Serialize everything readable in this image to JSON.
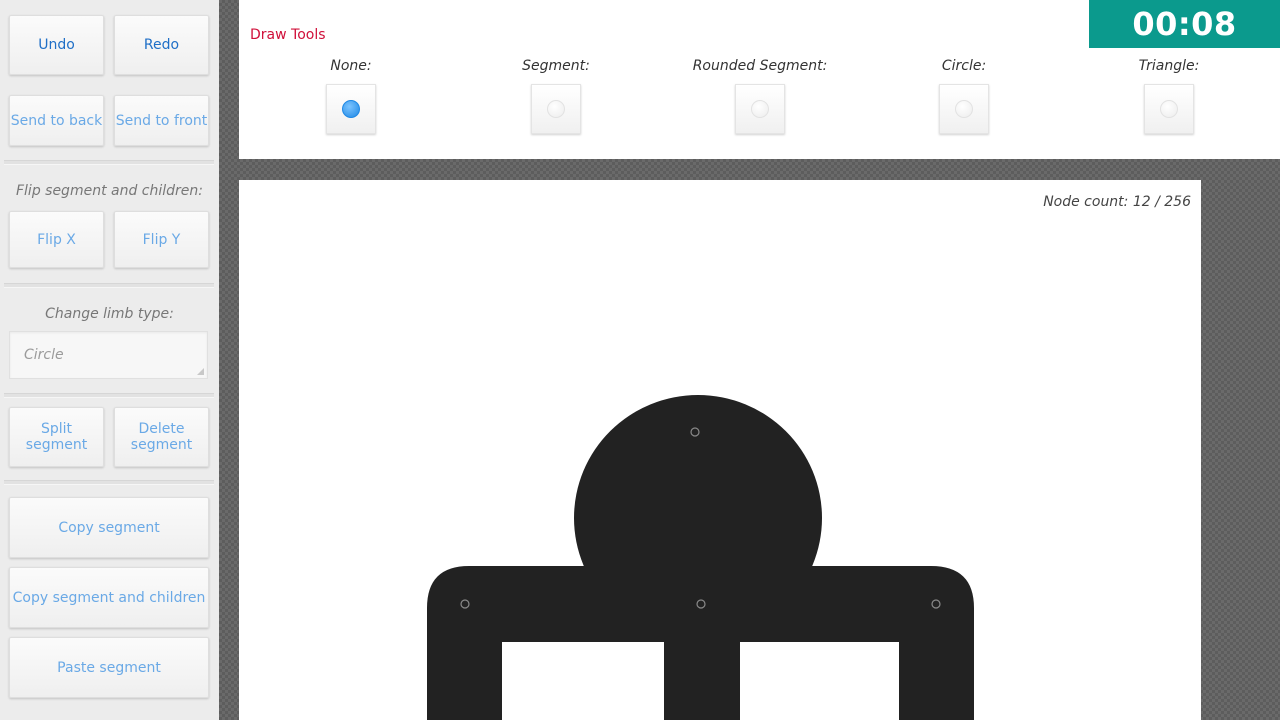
{
  "sidebar": {
    "undo": "Undo",
    "redo": "Redo",
    "send_to_back": "Send to back",
    "send_to_front": "Send to front",
    "flip_label": "Flip segment and children:",
    "flip_x": "Flip X",
    "flip_y": "Flip Y",
    "limb_label": "Change limb type:",
    "limb_value": "Circle",
    "split_segment": "Split segment",
    "delete_segment": "Delete segment",
    "copy_segment": "Copy segment",
    "copy_segment_children": "Copy segment and children",
    "paste_segment": "Paste segment"
  },
  "toolbar": {
    "title": "Draw Tools",
    "tools": [
      {
        "label": "None:",
        "selected": true
      },
      {
        "label": "Segment:",
        "selected": false
      },
      {
        "label": "Rounded Segment:",
        "selected": false
      },
      {
        "label": "Circle:",
        "selected": false
      },
      {
        "label": "Triangle:",
        "selected": false
      }
    ]
  },
  "timer": "00:08",
  "canvas": {
    "node_count": "Node count: 12 / 256",
    "figure_color": "#222222"
  },
  "colors": {
    "accent_teal": "#0b9a8d",
    "title_red": "#d0103a",
    "button_text": "#6aa9e6",
    "radio_selected": "#1e88e5"
  }
}
